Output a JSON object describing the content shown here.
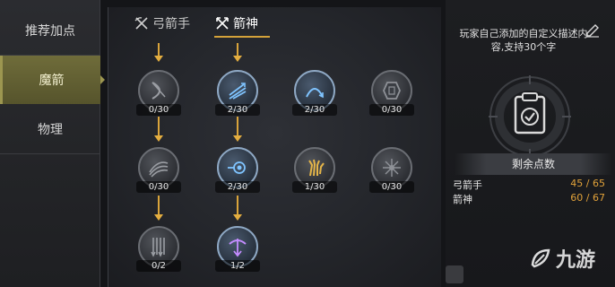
{
  "sidebar": {
    "items": [
      {
        "label": "推荐加点"
      },
      {
        "label": "魔箭"
      },
      {
        "label": "物理"
      }
    ]
  },
  "tabs": [
    {
      "label": "弓箭手",
      "icon": "crossed-bows-icon"
    },
    {
      "label": "箭神",
      "icon": "crossed-arrows-icon"
    }
  ],
  "talents": [
    {
      "count": "0/30",
      "icon": "bow-icon"
    },
    {
      "count": "2/30",
      "icon": "triple-arrow-icon"
    },
    {
      "count": "2/30",
      "icon": "arc-arrow-icon"
    },
    {
      "count": "0/30",
      "icon": "rune-shield-icon"
    },
    {
      "count": "0/30",
      "icon": "wind-slash-icon"
    },
    {
      "count": "2/30",
      "icon": "spiral-arrow-icon"
    },
    {
      "count": "1/30",
      "icon": "golden-claw-icon"
    },
    {
      "count": "0/30",
      "icon": "burst-icon"
    },
    {
      "count": "0/2",
      "icon": "arrow-rain-icon"
    },
    {
      "count": "1/2",
      "icon": "crossbow-icon"
    }
  ],
  "right_panel": {
    "description": "玩家自己添加的自定义描述内容,支持30个字",
    "remaining_title": "剩余点数",
    "rows": [
      {
        "label": "弓箭手",
        "value": "45 / 65"
      },
      {
        "label": "箭神",
        "value": "60 / 67"
      }
    ]
  },
  "watermark": "九游",
  "colors": {
    "accent": "#d9a43b",
    "sidebar_active": "#5f5d33",
    "value": "#e0a13a"
  }
}
